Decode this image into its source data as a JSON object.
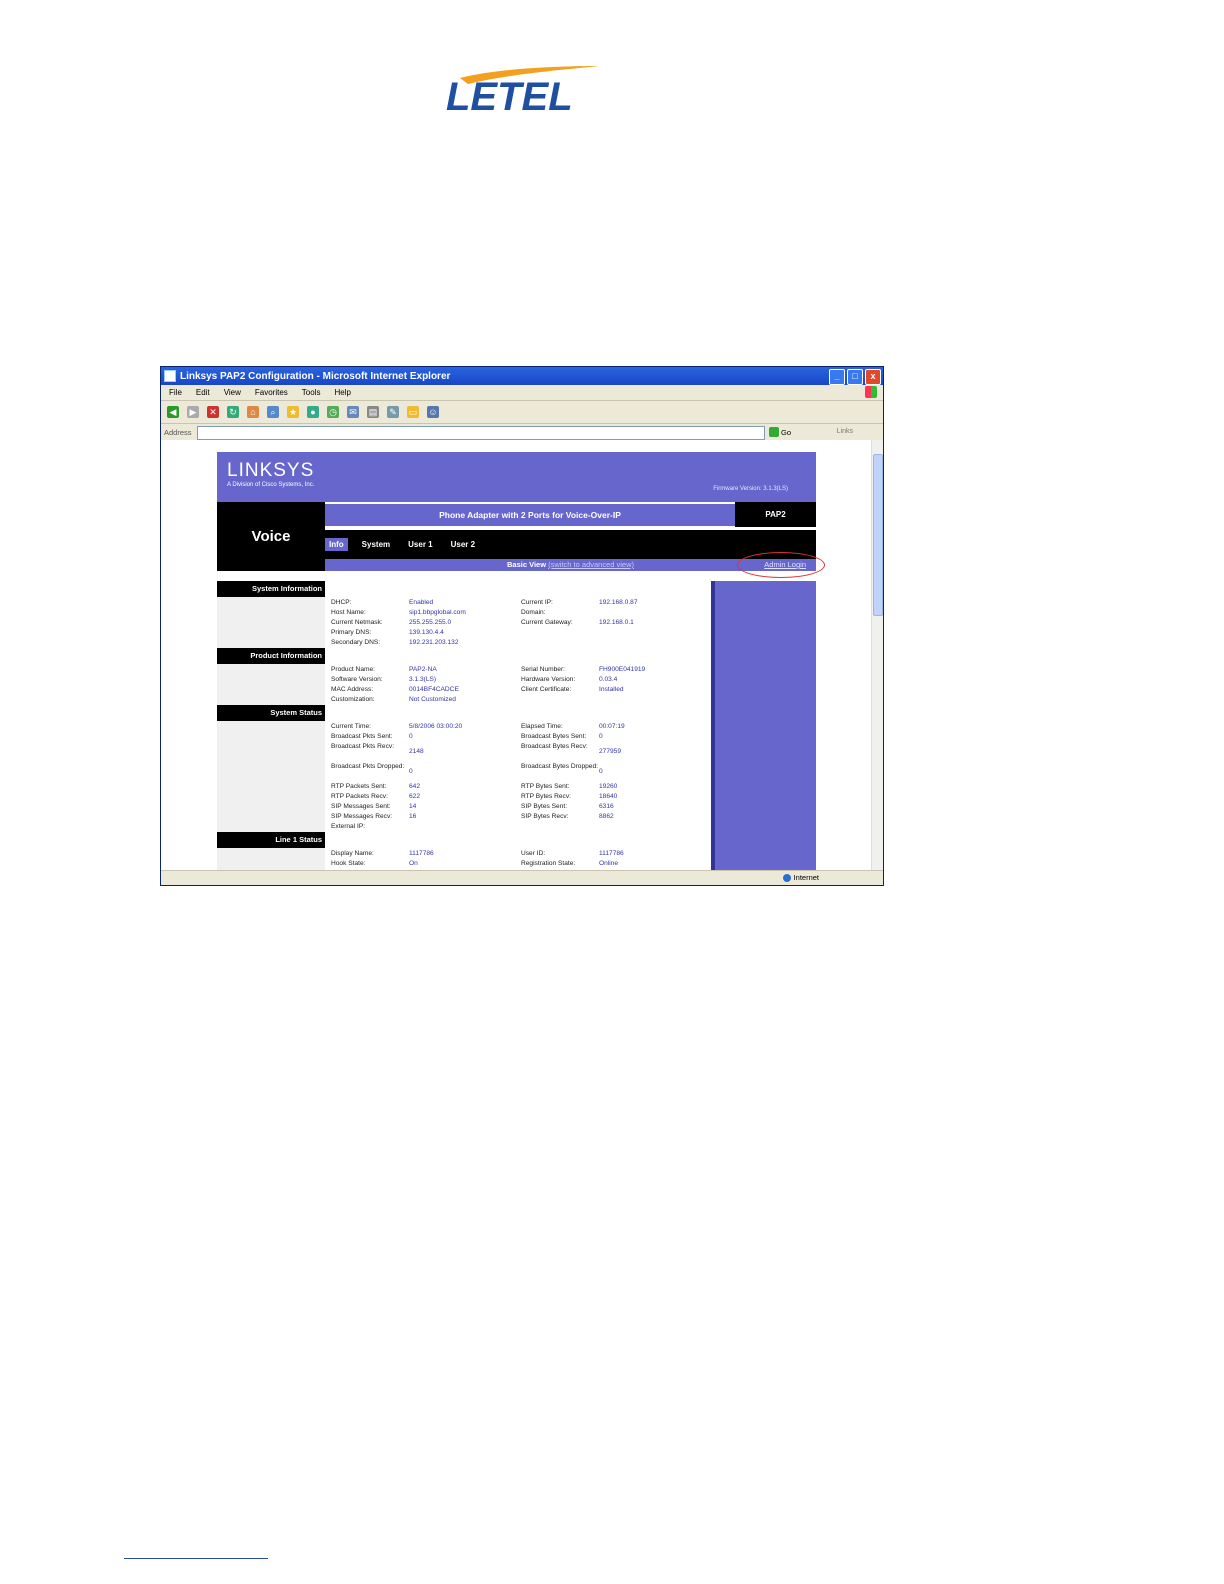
{
  "window": {
    "title": "Linksys PAP2 Configuration - Microsoft Internet Explorer",
    "buttons": {
      "min": "_",
      "max": "□",
      "close": "x"
    }
  },
  "menu": [
    "File",
    "Edit",
    "View",
    "Favorites",
    "Tools",
    "Help"
  ],
  "address": {
    "label": "Address",
    "go": "Go",
    "links": "Links"
  },
  "status": {
    "zone": "Internet"
  },
  "linksys": {
    "brand": "LINKSYS",
    "subtitle": "A Division of Cisco Systems, Inc.",
    "firmware": "Firmware Version: 3.1.3(LS)",
    "section": "Voice",
    "product_title": "Phone Adapter with 2 Ports for Voice-Over-IP",
    "model": "PAP2",
    "tabs": [
      "Info",
      "System",
      "User 1",
      "User 2"
    ],
    "basic_view": "Basic View",
    "switch_view": "(switch to advanced view)",
    "admin_login": "Admin Login",
    "sections": {
      "system_info": "System Information",
      "product_info": "Product Information",
      "system_status": "System Status",
      "line1_status": "Line 1 Status"
    },
    "system_info_rows": [
      [
        "DHCP:",
        "Enabled",
        "Current IP:",
        "192.168.0.87"
      ],
      [
        "Host Name:",
        "sip1.bbpglobal.com",
        "Domain:",
        ""
      ],
      [
        "Current Netmask:",
        "255.255.255.0",
        "Current Gateway:",
        "192.168.0.1"
      ],
      [
        "Primary DNS:",
        "139.130.4.4",
        "",
        ""
      ],
      [
        "Secondary DNS:",
        "192.231.203.132",
        "",
        ""
      ]
    ],
    "product_info_rows": [
      [
        "Product Name:",
        "PAP2-NA",
        "Serial Number:",
        "FH900E041919"
      ],
      [
        "Software Version:",
        "3.1.3(LS)",
        "Hardware Version:",
        "0.03.4"
      ],
      [
        "MAC Address:",
        "0014BF4CADCE",
        "Client Certificate:",
        "Installed"
      ],
      [
        "Customization:",
        "Not Customized",
        "",
        ""
      ]
    ],
    "system_status_rows": [
      [
        "Current Time:",
        "5/8/2006 03:00:20",
        "Elapsed Time:",
        "00:07:19"
      ],
      [
        "Broadcast Pkts Sent:",
        "0",
        "Broadcast Bytes Sent:",
        "0"
      ],
      [
        "Broadcast Pkts Recv:",
        "2148",
        "Broadcast Bytes Recv:",
        "277959"
      ],
      [
        "Broadcast Pkts Dropped:",
        "0",
        "Broadcast Bytes Dropped:",
        "0"
      ],
      [
        "RTP Packets Sent:",
        "642",
        "RTP Bytes Sent:",
        "19260"
      ],
      [
        "RTP Packets Recv:",
        "622",
        "RTP Bytes Recv:",
        "18640"
      ],
      [
        "SIP Messages Sent:",
        "14",
        "SIP Bytes Sent:",
        "6316"
      ],
      [
        "SIP Messages Recv:",
        "16",
        "SIP Bytes Recv:",
        "8862"
      ],
      [
        "External IP:",
        "",
        "",
        ""
      ]
    ],
    "line1_rows": [
      [
        "Display Name:",
        "1117786",
        "User ID:",
        "1117786"
      ],
      [
        "Hook State:",
        "On",
        "Registration State:",
        "Online"
      ]
    ]
  },
  "colors": {
    "linksys_purple": "#6666cc",
    "logo_blue": "#1f4fa0",
    "logo_orange": "#f2a01e"
  },
  "logo_text": "LETEL"
}
